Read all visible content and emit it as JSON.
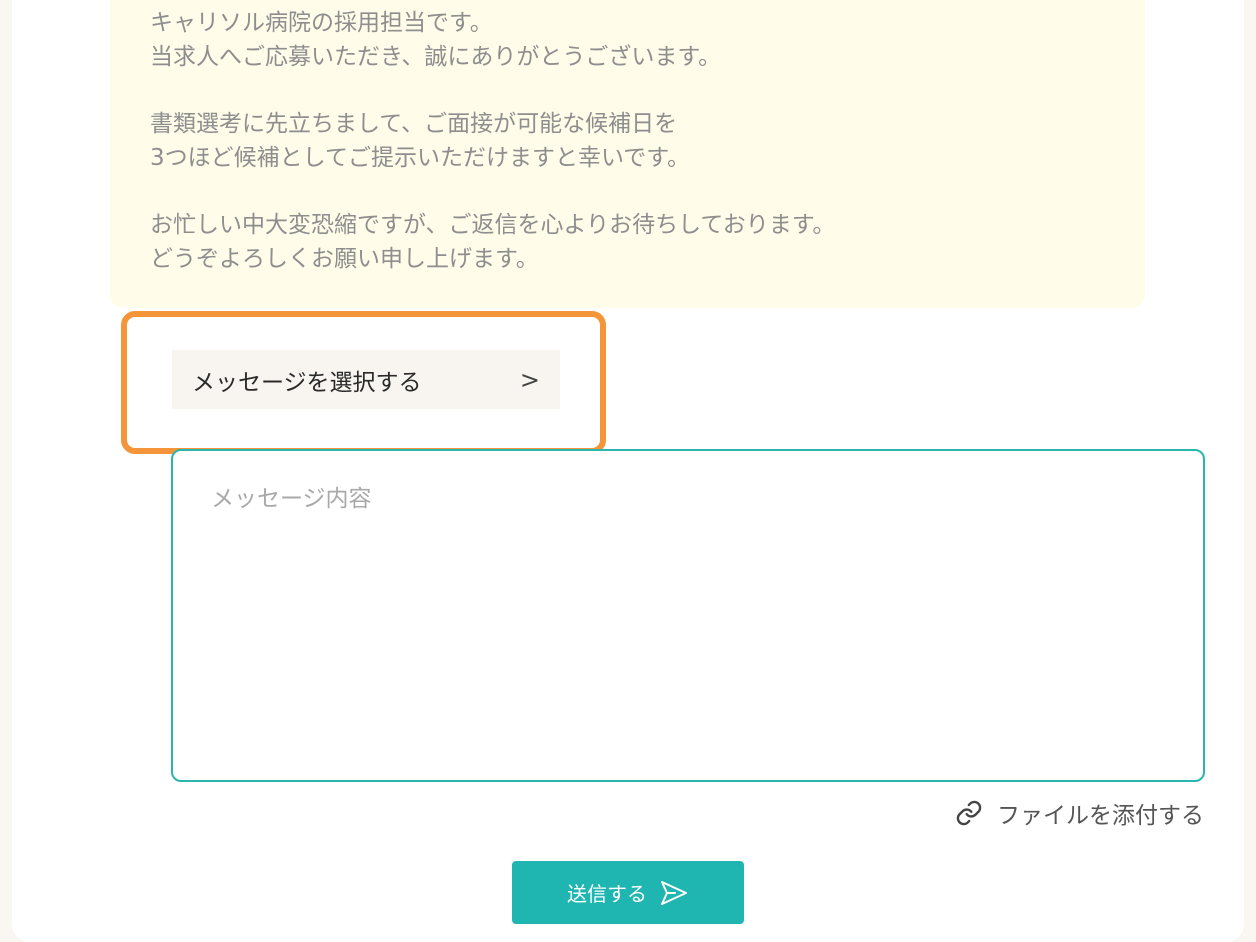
{
  "message": {
    "lines": [
      "キャリソル病院の採用担当です。",
      "当求人へご応募いただき、誠にありがとうございます。",
      "",
      "書類選考に先立ちまして、ご面接が可能な候補日を",
      "3つほど候補としてご提示いただけますと幸いです。",
      "",
      "お忙しい中大変恐縮ですが、ご返信を心よりお待ちしております。",
      "どうぞよろしくお願い申し上げます。"
    ]
  },
  "select_message": {
    "label": "メッセージを選択する",
    "chevron": ">"
  },
  "composer": {
    "placeholder": "メッセージ内容",
    "value": ""
  },
  "attach": {
    "label": "ファイルを添付する"
  },
  "send": {
    "label": "送信する"
  },
  "colors": {
    "accent": "#1fb5b0",
    "highlight": "#f39538",
    "bubble": "#fffce9"
  }
}
